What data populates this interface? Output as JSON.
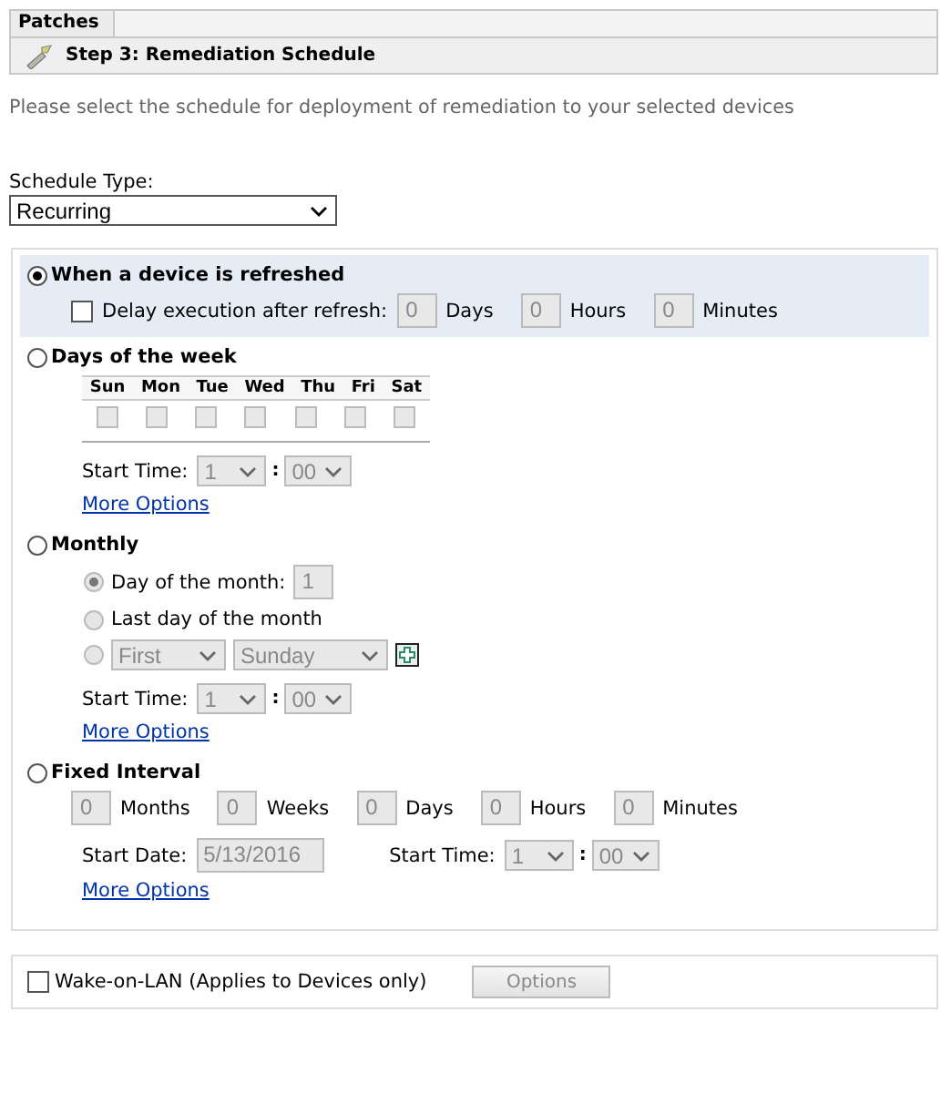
{
  "tab": {
    "label": "Patches"
  },
  "step": {
    "title": "Step 3: Remediation Schedule"
  },
  "instructions": "Please select the schedule for deployment of remediation to your selected devices",
  "schedule_type": {
    "label": "Schedule Type:",
    "value": "Recurring"
  },
  "options": [
    {
      "kind": "refresh",
      "label": "When a device is refreshed",
      "selected": true,
      "delay": {
        "label": "Delay execution after refresh:",
        "checked": false,
        "fields": [
          {
            "value": "0",
            "unit": "Days"
          },
          {
            "value": "0",
            "unit": "Hours"
          },
          {
            "value": "0",
            "unit": "Minutes"
          }
        ]
      }
    },
    {
      "kind": "weekly",
      "label": "Days of the week",
      "selected": false,
      "days": [
        {
          "label": "Sun",
          "checked": false
        },
        {
          "label": "Mon",
          "checked": false
        },
        {
          "label": "Tue",
          "checked": false
        },
        {
          "label": "Wed",
          "checked": false
        },
        {
          "label": "Thu",
          "checked": false
        },
        {
          "label": "Fri",
          "checked": false
        },
        {
          "label": "Sat",
          "checked": false
        }
      ],
      "start_time": {
        "label": "Start Time:",
        "hour": "1",
        "separator": ":",
        "minute": "00"
      },
      "link": "More Options"
    },
    {
      "kind": "monthly",
      "label": "Monthly",
      "selected": false,
      "choices": [
        {
          "kind": "day",
          "label": "Day of the month:",
          "value": "1",
          "selected": true
        },
        {
          "kind": "last",
          "label": "Last day of the month",
          "selected": false
        },
        {
          "kind": "nth",
          "ordinal": "First",
          "weekday": "Sunday",
          "selected": false
        }
      ],
      "start_time": {
        "label": "Start Time:",
        "hour": "1",
        "separator": ":",
        "minute": "00"
      },
      "link": "More Options"
    },
    {
      "kind": "interval",
      "label": "Fixed Interval",
      "selected": false,
      "fields": [
        {
          "value": "0",
          "unit": "Months"
        },
        {
          "value": "0",
          "unit": "Weeks"
        },
        {
          "value": "0",
          "unit": "Days"
        },
        {
          "value": "0",
          "unit": "Hours"
        },
        {
          "value": "0",
          "unit": "Minutes"
        }
      ],
      "start_date": {
        "label": "Start Date:",
        "value": "5/13/2016"
      },
      "start_time": {
        "label": "Start Time:",
        "hour": "1",
        "separator": ":",
        "minute": "00"
      },
      "link": "More Options"
    }
  ],
  "wake_on_lan": {
    "label": "Wake-on-LAN (Applies to Devices only)",
    "checked": false,
    "button": "Options"
  }
}
